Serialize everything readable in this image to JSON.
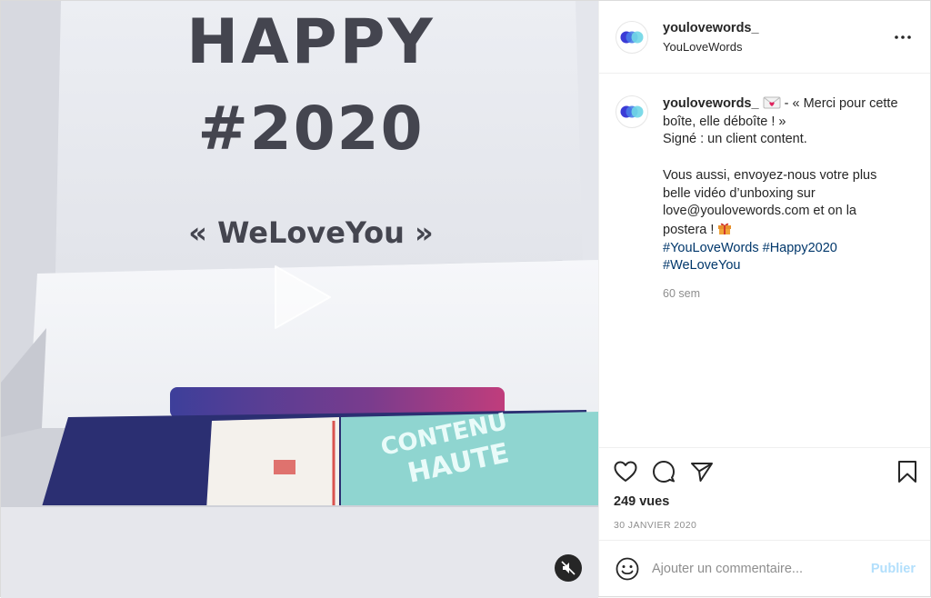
{
  "media": {
    "print_line1": "HAPPY",
    "print_line2": "#2020",
    "print_line3": "« WeLoveYou »",
    "play_icon": "play-icon",
    "mute_icon": "volume-muted-icon"
  },
  "post": {
    "username": "youlovewords_",
    "subtitle": "YouLoveWords",
    "more_icon": "more-horizontal-icon",
    "caption": {
      "username": "youlovewords_",
      "line1_after_emoji": " - « Merci pour cette boîte, elle déboîte ! »",
      "line2": "Signé : un client content.",
      "para2": "Vous aussi, envoyez-nous votre plus belle vidéo d’unboxing sur love@youlovewords.com et on la postera !",
      "hashtag1": "#YouLoveWords",
      "hashtag2": "#Happy2020",
      "hashtag3": "#WeLoveYou",
      "time_ago": "60 sem"
    },
    "views": "249 vues",
    "date": "30 JANVIER 2020"
  },
  "comment_box": {
    "placeholder": "Ajouter un commentaire...",
    "publish_label": "Publier"
  },
  "colors": {
    "link": "#00376b",
    "publish_disabled": "#b2dffc",
    "secondary_text": "#8e8e8e"
  }
}
